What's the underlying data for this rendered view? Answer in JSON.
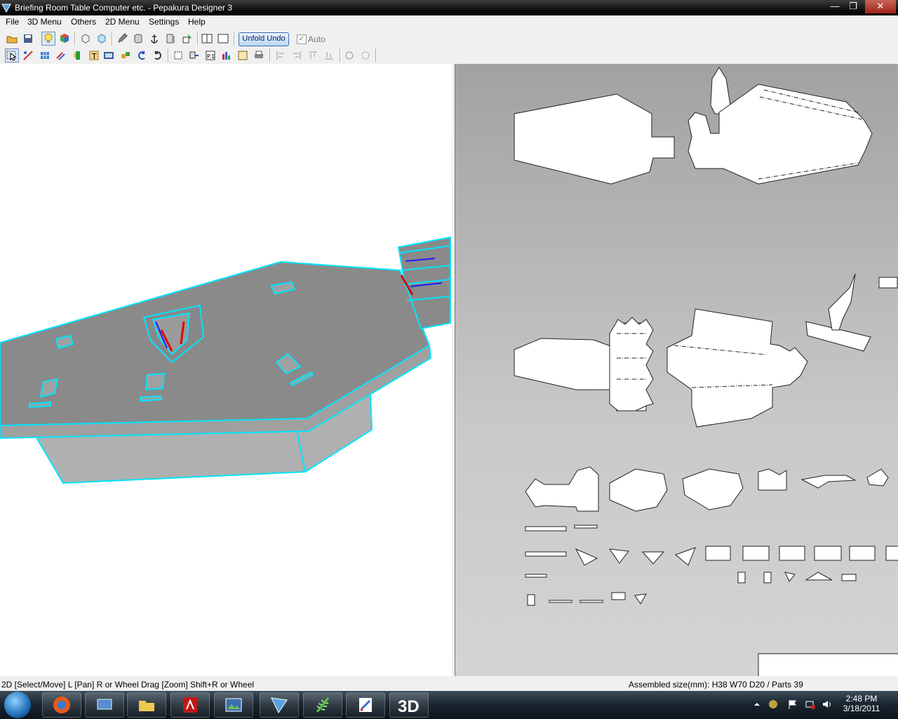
{
  "window": {
    "title": "Briefing Room Table Computer etc. - Pepakura Designer 3",
    "caption_buttons": [
      "minimize",
      "restore",
      "close"
    ]
  },
  "menu": [
    "File",
    "3D Menu",
    "Others",
    "2D Menu",
    "Settings",
    "Help"
  ],
  "toolbar1": {
    "unfold_undo_label": "Unfold Undo",
    "auto_label": "Auto",
    "auto_checked": true
  },
  "status": {
    "left": "2D [Select/Move] L [Pan] R or Wheel Drag [Zoom] Shift+R or Wheel",
    "right": "Assembled size(mm): H38 W70 D20 / Parts 39"
  },
  "taskbar": {
    "apps": [
      "start-orb",
      "firefox-icon",
      "network-icon",
      "explorer-icon",
      "acrobat-icon",
      "photo-icon",
      "app-icon",
      "fern-icon",
      "paint-icon",
      "pepakura-3d-icon"
    ],
    "time": "2:48 PM",
    "date": "3/18/2011"
  },
  "colors": {
    "outline": "#00e5ff",
    "model_top": "#8a8a8a",
    "model_side": "#b0b0b0",
    "sheet": "#ffffff",
    "edge_red": "#e00000",
    "edge_blue": "#1a1aff"
  }
}
